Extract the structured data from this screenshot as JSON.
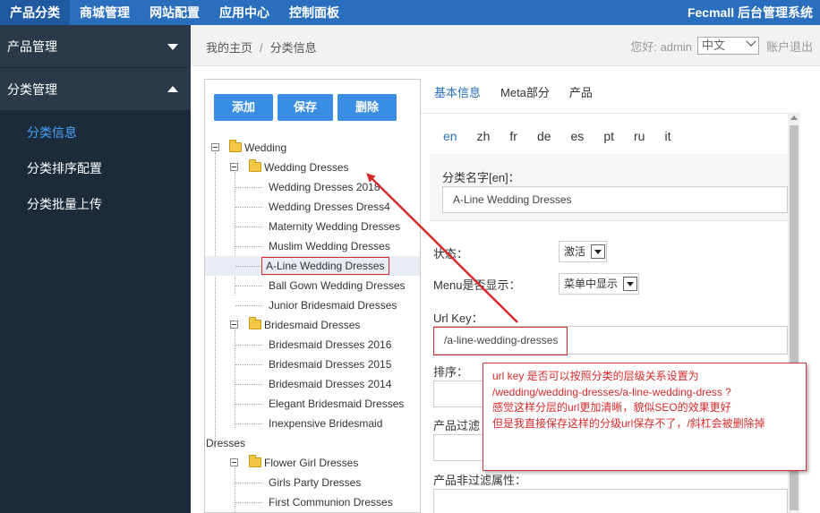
{
  "topnav": {
    "items": [
      "产品分类",
      "商城管理",
      "网站配置",
      "应用中心",
      "控制面板"
    ],
    "brand": "Fecmall 后台管理系统"
  },
  "sidebar": {
    "sections": [
      "产品管理",
      "分类管理"
    ],
    "sub_items": [
      "分类信息",
      "分类排序配置",
      "分类批量上传"
    ]
  },
  "header": {
    "breadcrumb": [
      "我的主页",
      "分类信息"
    ],
    "breadcrumb_sep": "/",
    "greeting": "您好: admin",
    "lang_selected": "中文",
    "logout": "账户退出"
  },
  "tree": {
    "buttons": [
      "添加",
      "保存",
      "删除"
    ],
    "nodes": [
      {
        "label": "Wedding"
      },
      {
        "label": "Wedding Dresses"
      },
      {
        "label": "Wedding Dresses 2018"
      },
      {
        "label": "Wedding Dresses Dress4"
      },
      {
        "label": "Maternity Wedding Dresses"
      },
      {
        "label": "Muslim Wedding Dresses"
      },
      {
        "label": "A-Line Wedding Dresses"
      },
      {
        "label": "Ball Gown Wedding Dresses"
      },
      {
        "label": "Junior Bridesmaid Dresses"
      },
      {
        "label": "Bridesmaid Dresses"
      },
      {
        "label": "Bridesmaid Dresses 2016"
      },
      {
        "label": "Bridesmaid Dresses 2015"
      },
      {
        "label": "Bridesmaid Dresses 2014"
      },
      {
        "label": "Elegant Bridesmaid Dresses"
      },
      {
        "label": "Inexpensive Bridesmaid"
      },
      {
        "label": "Dresses"
      },
      {
        "label": "Flower Girl Dresses"
      },
      {
        "label": "Girls Party Dresses"
      },
      {
        "label": "First Communion Dresses"
      }
    ]
  },
  "form": {
    "tabs": [
      "基本信息",
      "Meta部分",
      "产品"
    ],
    "lang_tabs": [
      "en",
      "zh",
      "fr",
      "de",
      "es",
      "pt",
      "ru",
      "it"
    ],
    "name_label": "分类名字[en]：",
    "name_value": "A-Line Wedding Dresses",
    "status_label": "状态：",
    "status_value": "激活",
    "menu_label": "Menu是否显示：",
    "menu_value": "菜单中显示",
    "urlkey_label": "Url Key：",
    "urlkey_value": "/a-line-wedding-dresses",
    "sort_label": "排序：",
    "filter_label": "产品过滤",
    "nonfilter_label": "产品非过滤属性："
  },
  "annotation": {
    "lines": [
      "url key 是否可以按照分类的层级关系设置为",
      "/wedding/wedding-dresses/a-line-wedding-dress ?",
      "感觉这样分层的url更加清晰，貌似SEO的效果更好",
      "但是我直接保存这样的分级url保存不了，/斜杠会被删除掉"
    ]
  },
  "colors": {
    "topbar": "#2a6fbd",
    "sidebar": "#1c2b39",
    "accent": "#3a8de4",
    "annotation": "#d42b2b"
  }
}
